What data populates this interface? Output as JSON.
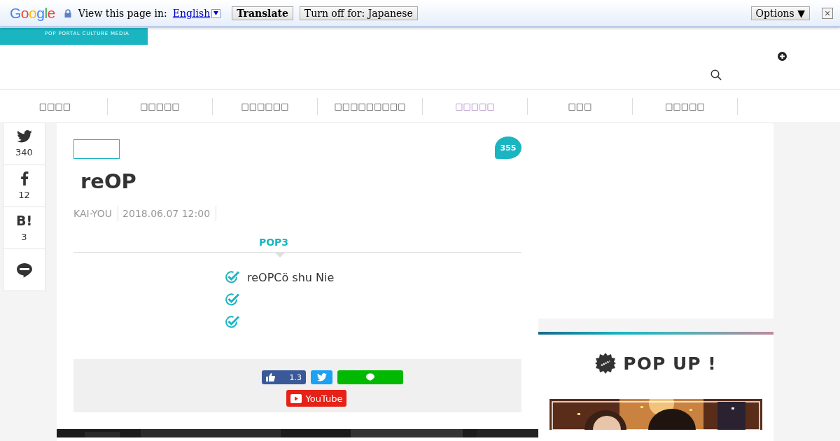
{
  "translate_bar": {
    "logo": "Google",
    "prompt": "View this page in:",
    "language": "English",
    "translate_button": "Translate",
    "turn_off_button": "Turn off for: Japanese",
    "options_button": "Options ▼",
    "close": "×"
  },
  "header": {
    "tagline": "POP PORTAL CULTURE MEDIA"
  },
  "nav": [
    {
      "label": "□□□□",
      "selected": false
    },
    {
      "label": "□□□□□",
      "selected": false
    },
    {
      "label": "□□□□□□",
      "selected": false
    },
    {
      "label": "□□□□□□□□□",
      "selected": false
    },
    {
      "label": "□□□□□",
      "selected": true
    },
    {
      "label": "□□□",
      "selected": false
    },
    {
      "label": "□□□□□",
      "selected": false
    }
  ],
  "share_rail": [
    {
      "kind": "twitter",
      "count": "340"
    },
    {
      "kind": "facebook",
      "count": "12"
    },
    {
      "kind": "hatena",
      "label": "B!",
      "count": "3"
    },
    {
      "kind": "line"
    }
  ],
  "article": {
    "comment_count": "355",
    "title": "reOP",
    "author": "KAI-YOU",
    "date": "2018.06.07 12:00",
    "summary_heading": "POP3",
    "points": [
      {
        "kind": "text",
        "text": "reOPCö shu Nie"
      },
      {
        "kind": "blank"
      },
      {
        "kind": "blank"
      }
    ],
    "share_buttons": [
      {
        "kind": "like",
        "count": "1.3"
      },
      {
        "kind": "twitter"
      },
      {
        "kind": "line"
      },
      {
        "kind": "youtube",
        "label": "YouTube"
      }
    ]
  },
  "sidebar": {
    "popup_title": "POP UP !"
  }
}
